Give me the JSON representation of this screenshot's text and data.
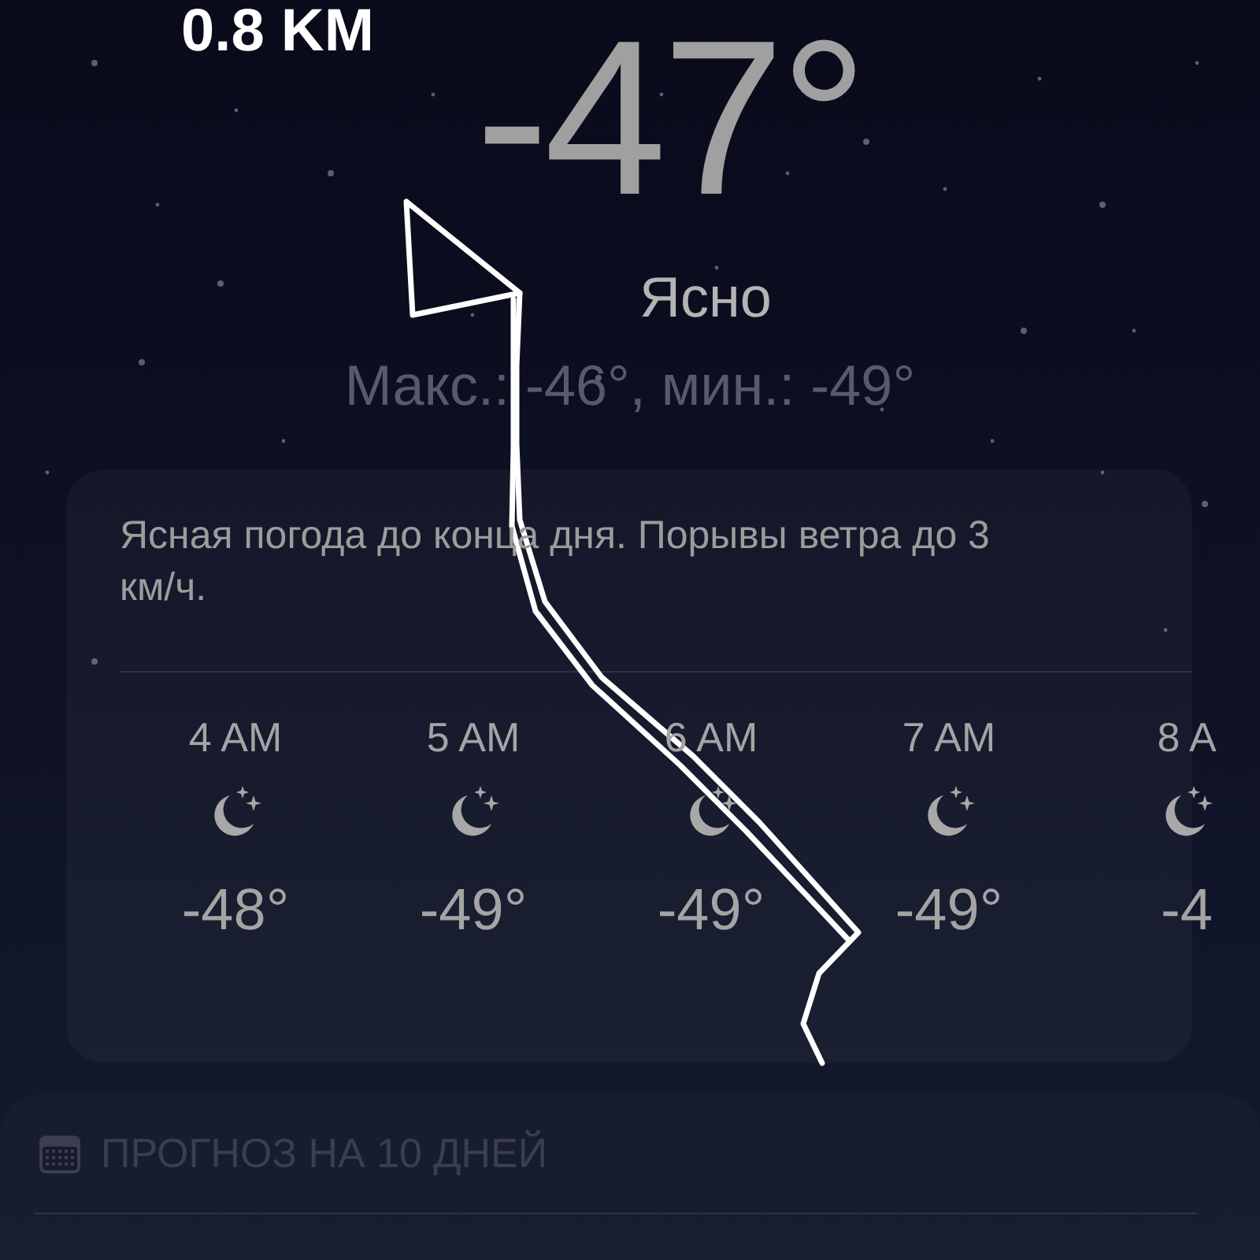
{
  "header": {
    "distance": "0.8 KM",
    "temperature": "-47°",
    "condition": "Ясно",
    "high_low": "Макс.: -46°, мин.: -49°"
  },
  "hourly": {
    "summary": "Ясная погода до конца дня. Порывы ветра до 3 км/ч.",
    "hours": [
      {
        "time": "4 AM",
        "temp": "-48°"
      },
      {
        "time": "5 AM",
        "temp": "-49°"
      },
      {
        "time": "6 AM",
        "temp": "-49°"
      },
      {
        "time": "7 AM",
        "temp": "-49°"
      },
      {
        "time": "8 A",
        "temp": "-4"
      }
    ]
  },
  "forecast": {
    "title": "ПРОГНОЗ НА 10 ДНЕЙ"
  }
}
